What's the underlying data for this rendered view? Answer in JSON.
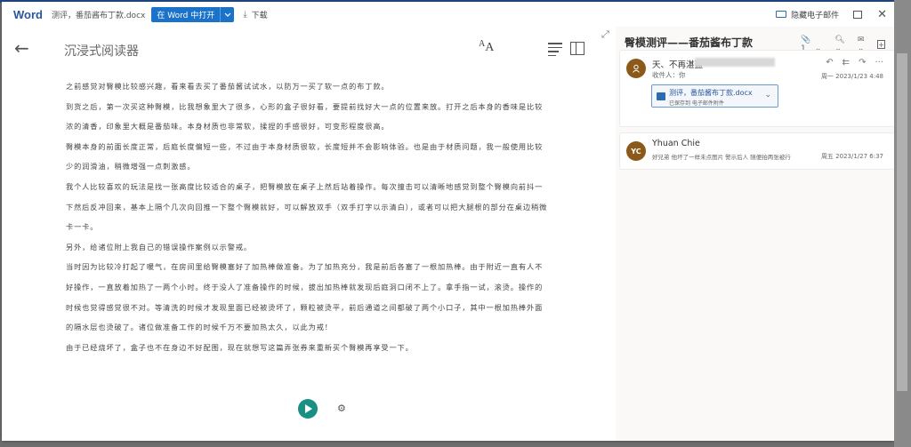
{
  "titlebar": {
    "brand": "Word",
    "document_name": "测评，番茄酱布丁款.docx",
    "open_in_word": "在 Word 中打开",
    "open_dropdown_icon": "chevron-down",
    "download_icon": "download",
    "download": "下载",
    "hide_email_icon": "mail-hide",
    "hide_email": "隐藏电子邮件",
    "popout_icon": "popout",
    "close_icon": "close"
  },
  "reader": {
    "back_icon": "arrow-left",
    "title": "沉浸式阅读器",
    "text_options_icon": "text-size",
    "text_options_small": "A",
    "text_options_big": "A",
    "grammar_icon": "grammar-options",
    "reading_prefs_icon": "book",
    "expand_icon": "expand",
    "paragraphs": [
      "之前感觉对臀模比较感兴趣，看来看去买了番茄酱试试水，以防万一买了软一点的布丁款。",
      "到货之后，第一次买这种臀模，比我想象里大了很多，心形的盒子很好看，要提前找好大一点的位置来放。打开之后本身的香味是比较浓的清香，印象里大概是番茄味。本身材质也非常软，揉捏的手感很好，可变形程度很高。",
      "臀模本身的前面长度正常，后庭长度偏短一些，不过由于本身材质很软，长度短并不会影响体验。也是由于材质问题，我一般使用比较少的润滑油，稍微增强一点刺激感。",
      "我个人比较喜欢的玩法是找一张高度比较适合的桌子，把臀模放在桌子上然后站着操作。每次撞击可以清晰地感觉到整个臀模向前抖一下然后反冲回来，基本上隔个几次向回推一下整个臀模就好，可以解放双手（双手打字以示清白），或者可以把大腿根的部分在桌边稍微卡一卡。",
      "另外，给诸位附上我自己的错误操作案例以示警戒。",
      "当时因为比较冷打起了暖气，在房间里给臀模塞好了加热棒做准备。为了加热充分，我是前后各塞了一根加热棒。由于附近一直有人不好操作，一直放着加热了一两个小时。终于没人了准备操作的时候，拔出加热棒就发现后庭洞口闭不上了。拿手指一试，滚烫。操作的时候也觉得感觉很不对。等清洗的时候才发现里面已经被烫坏了，颗粒被烫平，前后通道之间都破了两个小口子，其中一根加热棒外面的隔水层也烫破了。诸位做准备工作的时候千万不要加热太久，以此为戒！",
      "由于已经烧坏了，盒子也不在身边不好配图，现在就想写这篇弄张券来重新买个臀模再享受一下。"
    ],
    "play_icon": "play",
    "voice_settings_icon": "voice-settings"
  },
  "mail": {
    "subject": "臀模测评——番茄酱布丁款",
    "attachment_count_icon": "paperclip",
    "attachment_count": "1",
    "zoom_icon": "zoom",
    "read_icon": "envelope-open",
    "expand_icon": "plus-box",
    "messages": [
      {
        "avatar_icon": "person",
        "sender": "天、不再湛蓝",
        "recipients": "收件人：你",
        "date": "周一 2023/1/23 4:48",
        "reply_icon": "reply",
        "reply_all_icon": "reply-all",
        "forward_icon": "forward",
        "more_icon": "more",
        "attachment": {
          "icon": "word-file",
          "name": "测评，番茄酱布丁款.docx",
          "status": "已保存到 电子邮件附件",
          "chevron_icon": "chevron-down"
        }
      },
      {
        "avatar_initials": "YC",
        "sender": "Yhuan Chie",
        "preview": "好兄弟 他坏了一样未点图片 警示后人 随便拍两张被行",
        "date": "周五 2023/1/27 6:37"
      }
    ]
  },
  "colors": {
    "word_brand": "#2b579a",
    "open_button": "#1a73c8",
    "play_button": "#1a8f83",
    "avatar": "#8b5a1a"
  }
}
